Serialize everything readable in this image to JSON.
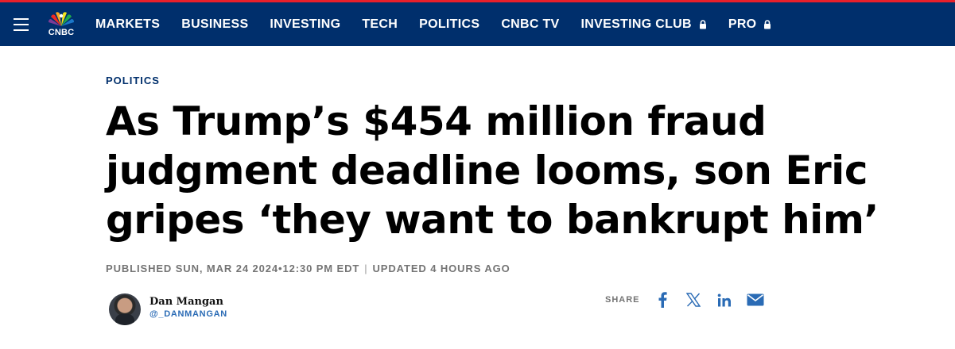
{
  "nav": {
    "logo_text": "CNBC",
    "items": [
      {
        "label": "MARKETS",
        "locked": false
      },
      {
        "label": "BUSINESS",
        "locked": false
      },
      {
        "label": "INVESTING",
        "locked": false
      },
      {
        "label": "TECH",
        "locked": false
      },
      {
        "label": "POLITICS",
        "locked": false
      },
      {
        "label": "CNBC TV",
        "locked": false
      },
      {
        "label": "INVESTING CLUB",
        "locked": true
      },
      {
        "label": "PRO",
        "locked": true
      }
    ]
  },
  "article": {
    "section": "POLITICS",
    "headline": "As Trump’s $454 million fraud judgment deadline looms, son Eric gripes ‘they want to bankrupt him’",
    "published": "PUBLISHED SUN, MAR 24 2024•12:30 PM EDT",
    "updated": "UPDATED 4 HOURS AGO",
    "separator": "|",
    "author": {
      "name": "Dan Mangan",
      "handle": "@_DANMANGAN"
    }
  },
  "share": {
    "label": "SHARE",
    "icons": [
      "facebook-icon",
      "x-icon",
      "linkedin-icon",
      "email-icon"
    ]
  },
  "colors": {
    "nav_bg": "#002f6c",
    "accent_red": "#e8202b",
    "link_blue": "#2a6bb5",
    "meta_gray": "#747474"
  }
}
